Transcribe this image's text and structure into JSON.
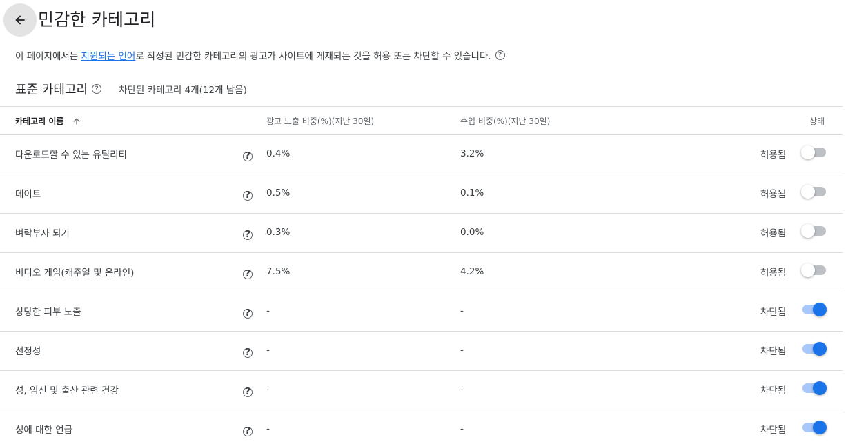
{
  "header": {
    "title": "민감한 카테고리"
  },
  "description": {
    "prefix": "이 페이지에서는 ",
    "link": "지원되는 언어",
    "suffix": "로 작성된 민감한 카테고리의 광고가 사이트에 게재되는 것을 허용 또는 차단할 수 있습니다."
  },
  "section": {
    "title": "표준 카테고리",
    "summary": "차단된 카테고리 4개(12개 남음)"
  },
  "table": {
    "columns": {
      "name": "카테고리 이름",
      "impressions": "광고 노출 비중(%)(지난 30일)",
      "revenue": "수입 비중(%)(지난 30일)",
      "status": "상태"
    },
    "rows": [
      {
        "name": "다운로드할 수 있는 유틸리티",
        "impressions": "0.4%",
        "revenue": "3.2%",
        "status": "허용됨",
        "blocked": false
      },
      {
        "name": "데이트",
        "impressions": "0.5%",
        "revenue": "0.1%",
        "status": "허용됨",
        "blocked": false
      },
      {
        "name": "벼락부자 되기",
        "impressions": "0.3%",
        "revenue": "0.0%",
        "status": "허용됨",
        "blocked": false
      },
      {
        "name": "비디오 게임(캐주얼 및 온라인)",
        "impressions": "7.5%",
        "revenue": "4.2%",
        "status": "허용됨",
        "blocked": false
      },
      {
        "name": "상당한 피부 노출",
        "impressions": "-",
        "revenue": "-",
        "status": "차단됨",
        "blocked": true
      },
      {
        "name": "선정성",
        "impressions": "-",
        "revenue": "-",
        "status": "차단됨",
        "blocked": true
      },
      {
        "name": "성, 임신 및 출산 관련 건강",
        "impressions": "-",
        "revenue": "-",
        "status": "차단됨",
        "blocked": true
      },
      {
        "name": "성에 대한 언급",
        "impressions": "-",
        "revenue": "-",
        "status": "차단됨",
        "blocked": true
      }
    ]
  },
  "icons": {
    "back": "arrow-back-icon",
    "help": "help-circle-icon",
    "sort": "arrow-up-icon"
  },
  "colors": {
    "link": "#1a73e8",
    "toggle_on": "#1a73e8",
    "toggle_on_track": "#a8c7fa",
    "toggle_off_track": "#bdc1c6"
  }
}
